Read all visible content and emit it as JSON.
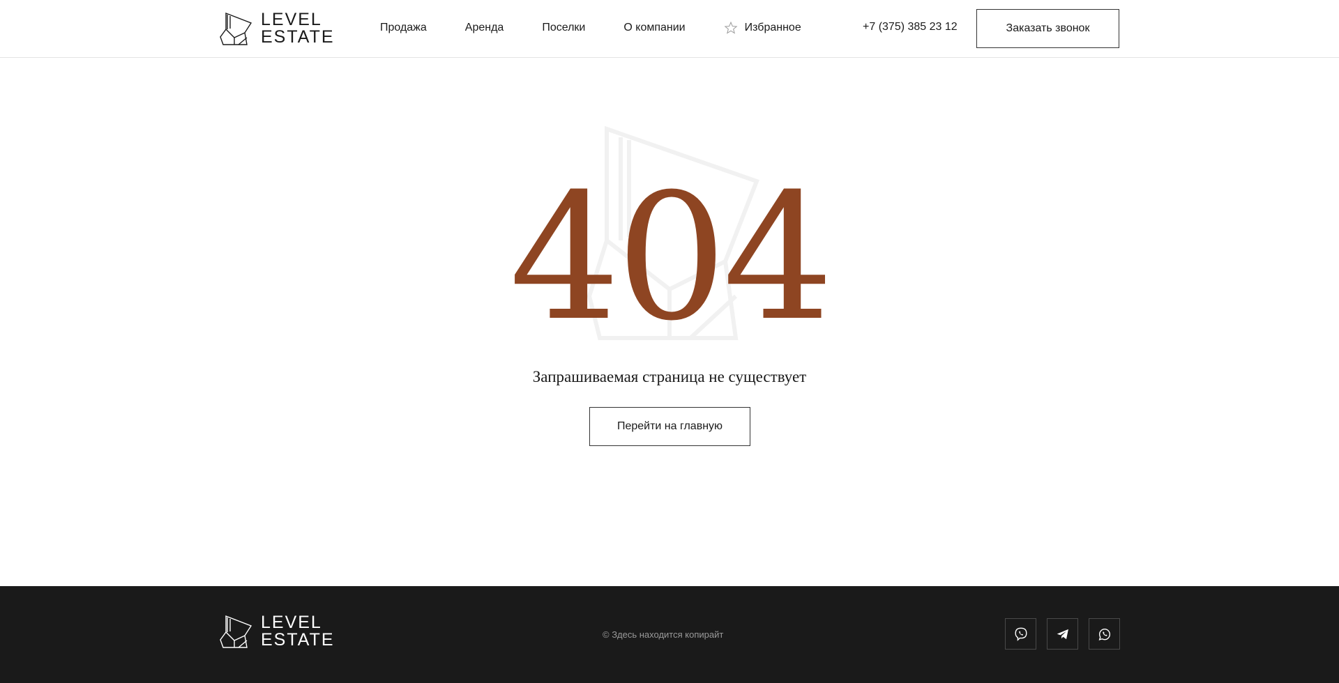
{
  "header": {
    "logo": {
      "line1": "LEVEL",
      "line2": "ESTATE"
    },
    "nav": [
      {
        "label": "Продажа"
      },
      {
        "label": "Аренда"
      },
      {
        "label": "Поселки"
      },
      {
        "label": "О компании"
      }
    ],
    "favorites": {
      "label": "Избранное",
      "icon": "star-icon"
    },
    "phone": "+7 (375) 385 23 12",
    "callback_label": "Заказать звонок"
  },
  "error": {
    "code": "404",
    "message": "Запрашиваемая страница не существует",
    "home_button_label": "Перейти на главную"
  },
  "footer": {
    "logo": {
      "line1": "LEVEL",
      "line2": "ESTATE"
    },
    "copyright": "© Здесь находится копирайт",
    "social": [
      {
        "icon": "viber-icon"
      },
      {
        "icon": "telegram-icon"
      },
      {
        "icon": "whatsapp-icon"
      }
    ]
  },
  "colors": {
    "accent": "#8e4522",
    "footer_bg": "#1a1a1a",
    "text": "#1a1a1a",
    "muted": "#9a9a9a"
  }
}
